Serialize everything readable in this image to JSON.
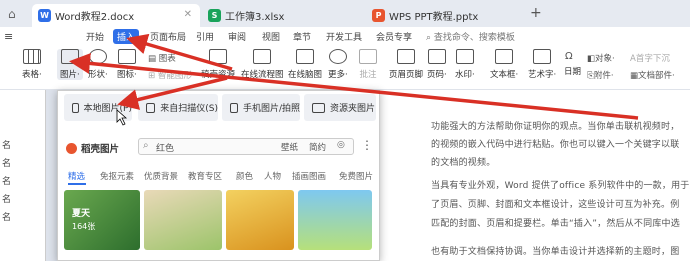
{
  "tabs": [
    {
      "label": "Word教程2.docx",
      "icon": "W",
      "color": "#2f6fe8",
      "active": true
    },
    {
      "label": "工作簿3.xlsx",
      "icon": "S",
      "color": "#1aa35b",
      "active": false
    },
    {
      "label": "WPS PPT教程.pptx",
      "icon": "P",
      "color": "#e8552f",
      "active": false
    }
  ],
  "new_tab": "+",
  "menu": [
    "开始",
    "插入",
    "页面布局",
    "引用",
    "审阅",
    "视图",
    "章节",
    "开发工具",
    "会员专享"
  ],
  "search_label": "查找命令、搜索模板",
  "toolbar": {
    "table": "表格·",
    "picture": "图片·",
    "shape": "形状·",
    "icon": "图标·",
    "chart": "图表",
    "smart_graphic": "智能图形",
    "material": "稿壳资源",
    "flowchart": "在线流程图",
    "mindmap": "在线脑图",
    "more": "更多·",
    "comment": "批注",
    "header_footer": "页眉页脚",
    "page_number": "页码·",
    "watermark": "水印·",
    "textbox": "文本框·",
    "art_text": "艺术字·",
    "date": "日期",
    "attachment": "附件·",
    "doc_part": "文档部件·",
    "object": "对象·",
    "first_drop": "首字下沉"
  },
  "dropdown": {
    "local_picture": "本地图片(P)",
    "scan": "来自扫描仪(S)",
    "phone": "手机图片/拍照",
    "resource": "资源夹图片",
    "gallery_title": "稻壳图片",
    "search_placeholder": "红色",
    "tags": [
      "壁纸",
      "简约"
    ],
    "categories": [
      "精选",
      "免抠元素",
      "优质背景",
      "教育专区",
      "颜色",
      "人物",
      "插画图画",
      "免费图片"
    ],
    "thumb_label": "夏天",
    "thumb_count": "164张"
  },
  "left_panel": [
    "名",
    "名",
    "名",
    "名",
    "名"
  ],
  "doc_lines": [
    "功能强大的方法帮助你证明你的观点。当你单击联机视频时，",
    "的视频的嵌入代码中进行粘贴。你也可以键入一个关键字以联",
    "的文档的视频。",
    "当具有专业外观，Word 提供了office 系列软件中的一款，用于处",
    "了页眉、页脚、封面和文本框设计，这些设计可互为补充。例",
    "匹配的封面、页眉和提要栏。单击“插入”，然后从不同库中选",
    "也有助于文档保持协调。当你单击设计并选择新的主题时，图"
  ],
  "colors": {
    "accent": "#2f6fe8",
    "arrow": "#d93025",
    "gallery": "#e8552f"
  }
}
